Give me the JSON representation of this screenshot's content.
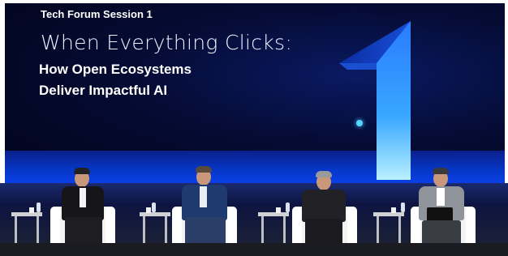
{
  "screen": {
    "session_label": "Tech Forum Session 1",
    "headline": "When Everything Clicks:",
    "subline_1": "How Open Ecosystems",
    "subline_2": "Deliver Impactful AI"
  },
  "colors": {
    "screen_bg": "#050b33",
    "accent_blue": "#1f6bff",
    "cyan_glow": "#53d6ff",
    "chair_white": "#f3f3f3"
  }
}
